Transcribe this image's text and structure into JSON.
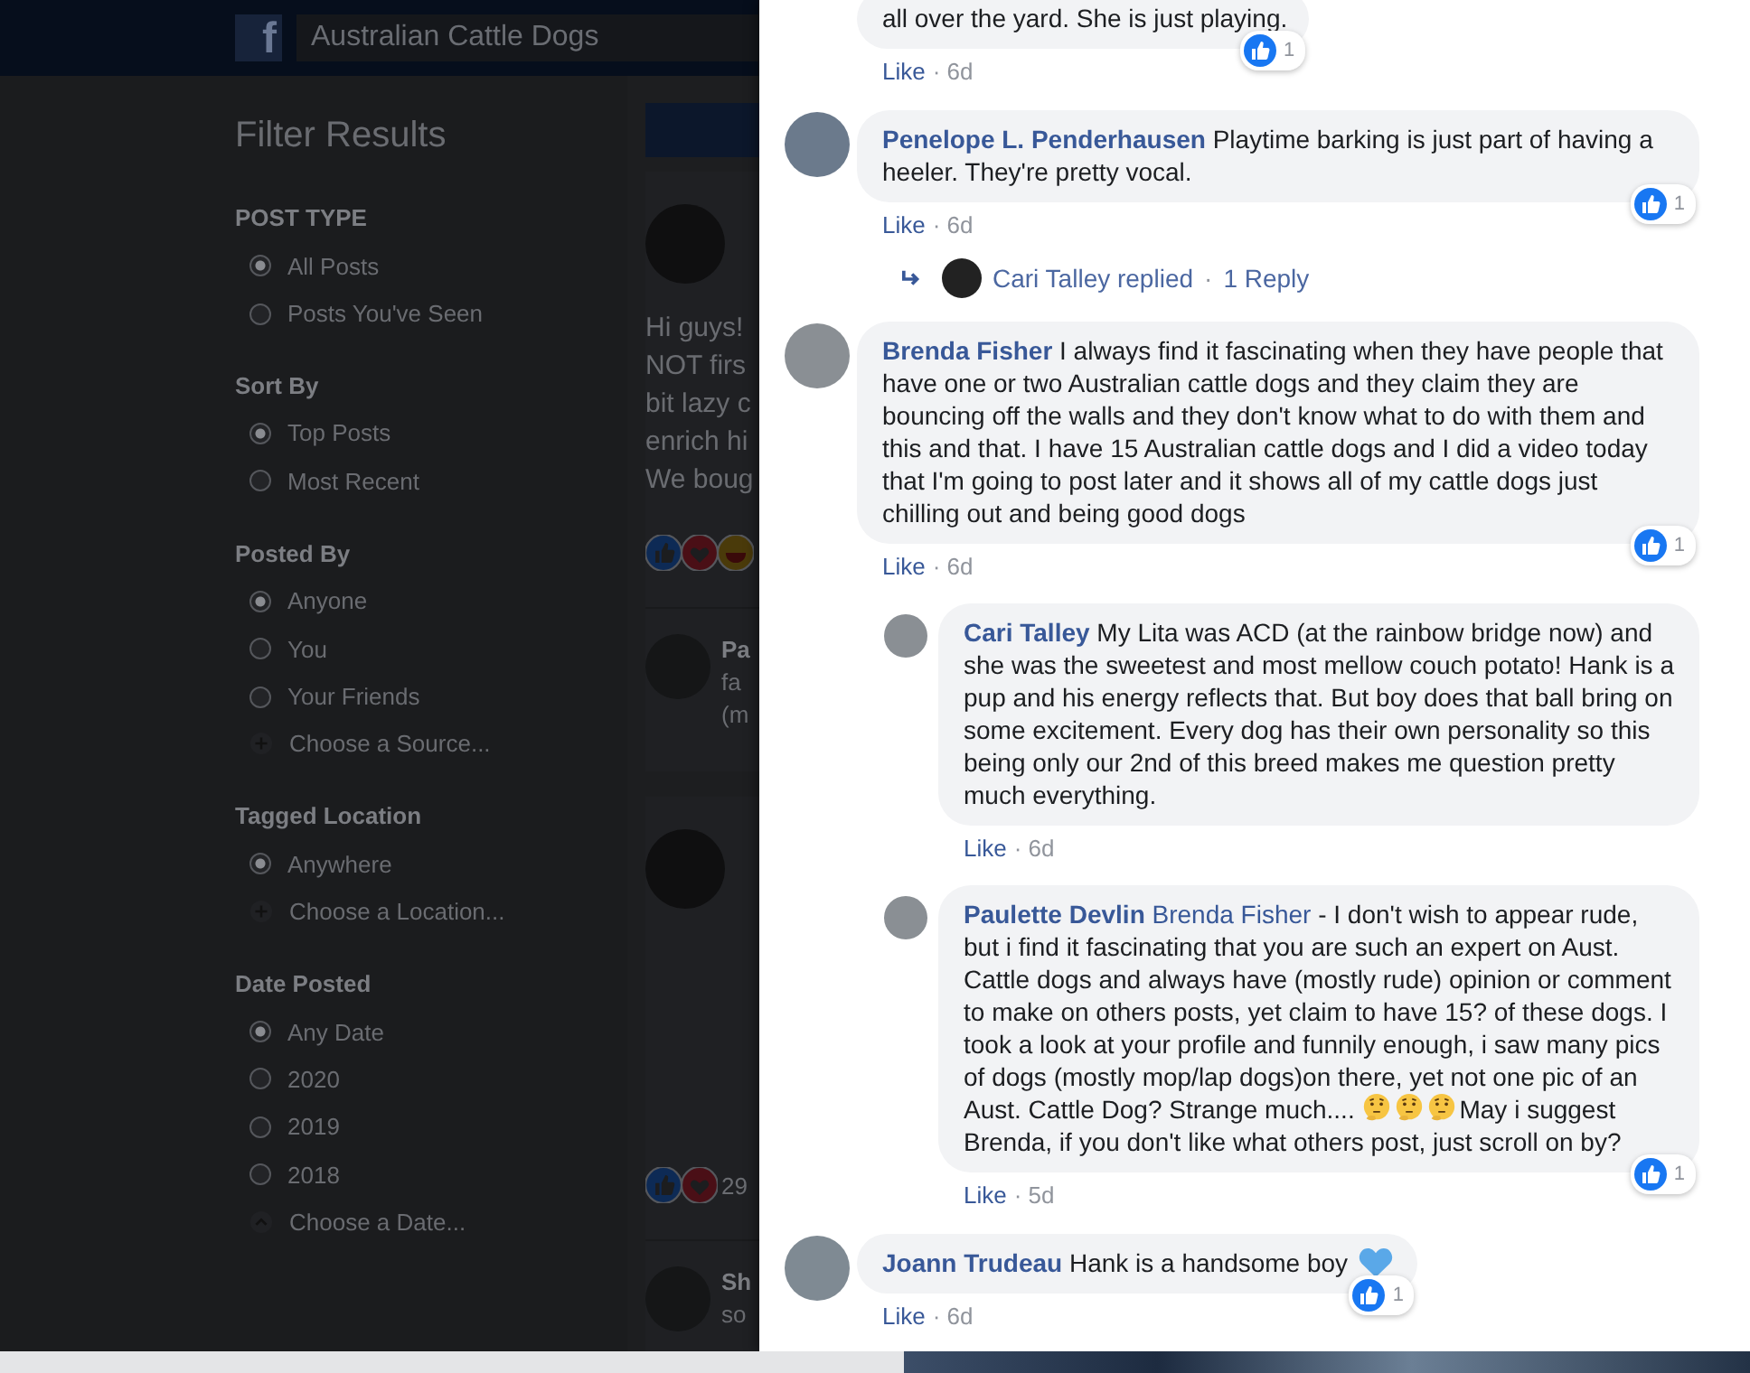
{
  "topbar": {
    "logo": "f",
    "search_value": "Australian Cattle Dogs"
  },
  "filters": {
    "title": "Filter Results",
    "sections": [
      {
        "heading": "POST TYPE",
        "options": [
          {
            "label": "All Posts",
            "kind": "radio",
            "selected": true
          },
          {
            "label": "Posts You've Seen",
            "kind": "radio",
            "selected": false
          }
        ]
      },
      {
        "heading": "Sort By",
        "options": [
          {
            "label": "Top Posts",
            "kind": "radio",
            "selected": true
          },
          {
            "label": "Most Recent",
            "kind": "radio",
            "selected": false
          }
        ]
      },
      {
        "heading": "Posted By",
        "options": [
          {
            "label": "Anyone",
            "kind": "radio",
            "selected": true
          },
          {
            "label": "You",
            "kind": "radio",
            "selected": false
          },
          {
            "label": "Your Friends",
            "kind": "radio",
            "selected": false
          },
          {
            "label": "Choose a Source...",
            "kind": "add",
            "selected": false
          }
        ]
      },
      {
        "heading": "Tagged Location",
        "options": [
          {
            "label": "Anywhere",
            "kind": "radio",
            "selected": true
          },
          {
            "label": "Choose a Location...",
            "kind": "add",
            "selected": false
          }
        ]
      },
      {
        "heading": "Date Posted",
        "options": [
          {
            "label": "Any Date",
            "kind": "radio",
            "selected": true
          },
          {
            "label": "2020",
            "kind": "radio",
            "selected": false
          },
          {
            "label": "2019",
            "kind": "radio",
            "selected": false
          },
          {
            "label": "2018",
            "kind": "radio",
            "selected": false
          },
          {
            "label": "Choose a Date...",
            "kind": "date",
            "selected": false
          }
        ]
      }
    ]
  },
  "feed": {
    "posts": [
      {
        "lines": [
          "Hi guys!",
          "NOT firs",
          "bit lazy c",
          "enrich hi",
          "We boug"
        ],
        "reactions": [
          {
            "kind": "like"
          },
          {
            "kind": "love"
          },
          {
            "kind": "haha"
          }
        ],
        "preview": {
          "author": "Pa",
          "lines": [
            "fa",
            "(m"
          ]
        }
      },
      {
        "reactions": [
          {
            "kind": "like"
          },
          {
            "kind": "love"
          }
        ],
        "reaction_count": "29",
        "preview": {
          "author": "Sh",
          "lines": [
            "so"
          ]
        }
      }
    ]
  },
  "comments_panel": {
    "top_fragment": {
      "text": "all over the yard. She is just playing.",
      "like": "Like",
      "meta": "· 6d",
      "reactions": "1"
    },
    "comments": [
      {
        "author": "Penelope L. Penderhausen",
        "segments": [
          {
            "kind": "text",
            "text": "Playtime barking is just part of having a heeler. They're pretty vocal."
          }
        ],
        "like": "Like",
        "meta": "· 6d",
        "reactions": "1",
        "reply_summary": {
          "name": "Cari Talley replied",
          "separator": "·",
          "count": "1 Reply"
        }
      },
      {
        "author": "Brenda Fisher",
        "segments": [
          {
            "kind": "text",
            "text": "I always find it fascinating when they have people that have one or two Australian cattle dogs and they claim they are bouncing off the walls and they don't know what to do with them and this and that. I have 15 Australian cattle dogs and I did a video today that I'm going to post later and it shows all of my cattle dogs just chilling out and being good dogs"
          }
        ],
        "like": "Like",
        "meta": "· 6d",
        "reactions": "1",
        "children": [
          {
            "author": "Cari Talley",
            "segments": [
              {
                "kind": "text",
                "text": "My Lita was ACD (at the rainbow bridge now) and she was the sweetest and most mellow couch potato! Hank is a pup and his energy reflects that. But boy does that ball bring on some excitement. Every dog has their own personality so this being only our 2nd of this breed makes me question pretty much everything."
              }
            ],
            "like": "Like",
            "meta": "· 6d"
          },
          {
            "author": "Paulette Devlin",
            "segments": [
              {
                "kind": "mention",
                "text": "Brenda Fisher"
              },
              {
                "kind": "text",
                "text": "- I don't wish to appear rude, but i find it fascinating that you are such an expert on Aust. Cattle dogs and always have (mostly rude) opinion or comment to make on others posts, yet claim to have 15? of these dogs. I took a look at your profile and funnily enough, i saw many pics of dogs (mostly mop/lap dogs)on there, yet not one pic of an Aust. Cattle Dog? Strange much...."
              },
              {
                "kind": "thinking"
              },
              {
                "kind": "thinking"
              },
              {
                "kind": "thinking"
              },
              {
                "kind": "text",
                "text": "May i suggest Brenda, if you don't like what others post, just scroll on by?"
              }
            ],
            "like": "Like",
            "meta": "· 5d",
            "reactions": "1"
          }
        ]
      },
      {
        "author": "Joann Trudeau",
        "segments": [
          {
            "kind": "text",
            "text": "Hank is a handsome boy"
          },
          {
            "kind": "heart"
          }
        ],
        "like": "Like",
        "meta": "· 6d",
        "reactions": "1"
      }
    ]
  }
}
